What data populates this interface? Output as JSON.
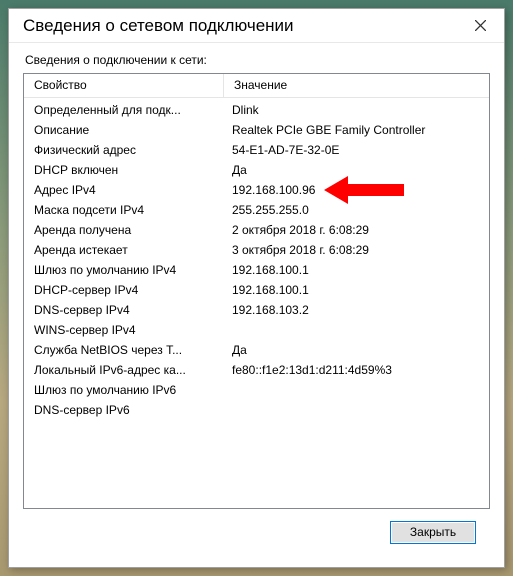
{
  "window": {
    "title": "Сведения о сетевом подключении",
    "close_label": "Close"
  },
  "subtitle": "Сведения о подключении к сети:",
  "columns": {
    "property": "Свойство",
    "value": "Значение"
  },
  "rows": [
    {
      "property": "Определенный для подк...",
      "value": "Dlink"
    },
    {
      "property": "Описание",
      "value": "Realtek PCIe GBE Family Controller"
    },
    {
      "property": "Физический адрес",
      "value": "54-E1-AD-7E-32-0E"
    },
    {
      "property": "DHCP включен",
      "value": "Да"
    },
    {
      "property": "Адрес IPv4",
      "value": "192.168.100.96"
    },
    {
      "property": "Маска подсети IPv4",
      "value": "255.255.255.0"
    },
    {
      "property": "Аренда получена",
      "value": "2 октября 2018 г. 6:08:29"
    },
    {
      "property": "Аренда истекает",
      "value": "3 октября 2018 г. 6:08:29"
    },
    {
      "property": "Шлюз по умолчанию IPv4",
      "value": "192.168.100.1"
    },
    {
      "property": "DHCP-сервер IPv4",
      "value": "192.168.100.1"
    },
    {
      "property": "DNS-сервер IPv4",
      "value": "192.168.103.2"
    },
    {
      "property": "WINS-сервер IPv4",
      "value": ""
    },
    {
      "property": "Служба NetBIOS через T...",
      "value": "Да"
    },
    {
      "property": "Локальный IPv6-адрес ка...",
      "value": "fe80::f1e2:13d1:d211:4d59%3"
    },
    {
      "property": "Шлюз по умолчанию IPv6",
      "value": ""
    },
    {
      "property": "DNS-сервер IPv6",
      "value": ""
    }
  ],
  "highlight_row_index": 4,
  "footer": {
    "close_button": "Закрыть"
  }
}
